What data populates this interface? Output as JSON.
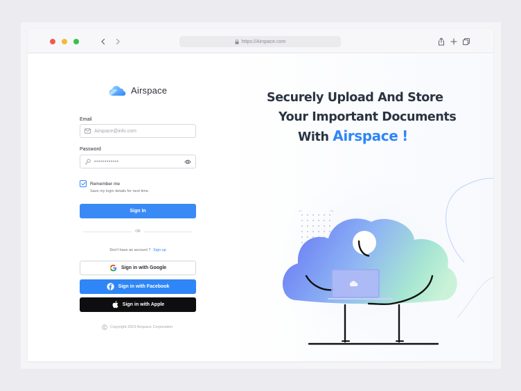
{
  "browser": {
    "url": "https://Airspace.com"
  },
  "brand": {
    "name": "Airspace",
    "accent_color": "#3a8af6"
  },
  "login_form": {
    "email_label": "Email",
    "email_placeholder": "Airspace@info.com",
    "password_label": "Password",
    "password_value": "••••••••••••",
    "remember_label": "Remember me",
    "remember_checked": true,
    "remember_sub": "Save my login details for next time.",
    "signin_label": "Sign In",
    "divider_text": "OR",
    "no_account_text": "Don't have an account ?",
    "signup_link": "Sign up"
  },
  "social": {
    "google_label": "Sign in with Google",
    "facebook_label": "Sign in with Facebook",
    "apple_label": "Sign in with Apple"
  },
  "footer": {
    "copyright": "Copyright 2023 Airspace Corporation"
  },
  "hero": {
    "line1": "Securely Upload And Store",
    "line2": "Your Important Documents",
    "line3_prefix": "With",
    "line3_brand": "Airspace",
    "line3_suffix": "!"
  },
  "icons": [
    "back-arrow-icon",
    "forward-arrow-icon",
    "lock-icon",
    "share-icon",
    "plus-icon",
    "tabs-icon",
    "cloud-logo-icon",
    "mail-icon",
    "key-icon",
    "eye-icon",
    "check-icon",
    "google-icon",
    "facebook-icon",
    "apple-icon",
    "copyright-icon"
  ]
}
